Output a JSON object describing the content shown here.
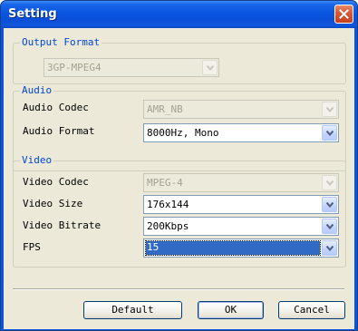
{
  "window": {
    "title": "Setting"
  },
  "output_format": {
    "legend": "Output Format",
    "format_value": "3GP-MPEG4"
  },
  "audio": {
    "legend": "Audio",
    "codec_label": "Audio Codec",
    "codec_value": "AMR_NB",
    "format_label": "Audio Format",
    "format_value": "8000Hz, Mono"
  },
  "video": {
    "legend": "Video",
    "codec_label": "Video Codec",
    "codec_value": "MPEG-4",
    "size_label": "Video Size",
    "size_value": "176x144",
    "bitrate_label": "Video Bitrate",
    "bitrate_value": "200Kbps",
    "fps_label": "FPS",
    "fps_value": "15"
  },
  "buttons": {
    "default_label": "Default",
    "ok_label": "OK",
    "cancel_label": "Cancel"
  },
  "icons": {
    "close": "close-icon",
    "dropdown": "chevron-down-icon"
  },
  "colors": {
    "titlebar": "#0a55e0",
    "dialog_background": "#ece9d8",
    "group_label": "#0046d5",
    "selection": "#316ac5",
    "close_button": "#d9593b"
  }
}
